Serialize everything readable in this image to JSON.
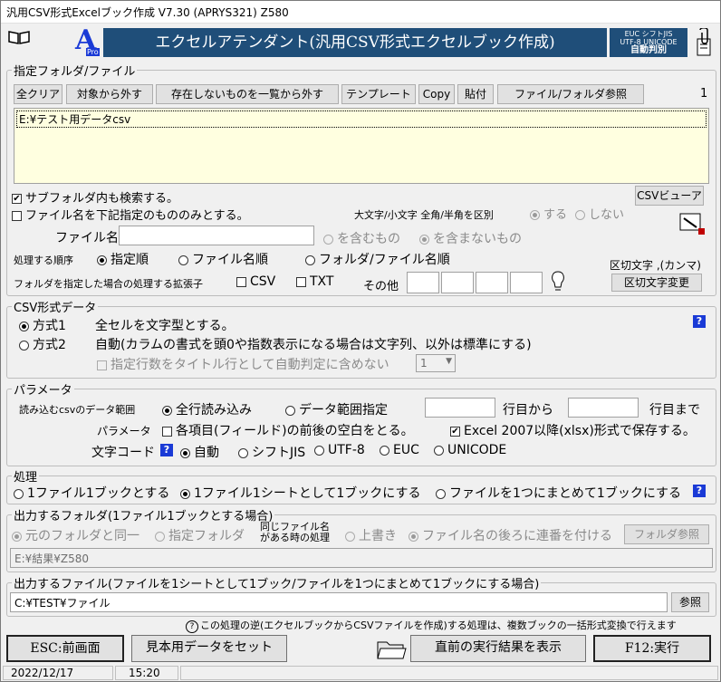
{
  "window": {
    "title": "汎用CSV形式Excelブック作成 V7.30 (APRYS321)  Z580"
  },
  "banner": {
    "title": "エクセルアテンダント(汎用CSV形式エクセルブック作成)"
  },
  "logo_right": {
    "line1": "EUC  シフトJIS",
    "line2": "UTF-8 UNICODE",
    "line3": "自動判別"
  },
  "logo_left": {
    "letter": "A",
    "sub": "Pro"
  },
  "files": {
    "legend": "指定フォルダ/ファイル",
    "toolbar": [
      "全クリア",
      "対象から外す",
      "存在しないものを一覧から外す",
      "テンプレート",
      "Copy",
      "貼付",
      "ファイル/フォルダ参照"
    ],
    "count": "1",
    "list": [
      "E:¥テスト用データcsv"
    ],
    "subfolder": "サブフォルダ内も検索する。",
    "only_named": "ファイル名を下記指定のもののみとする。",
    "csv_viewer": "CSVビューア",
    "case_label": "大文字/小文字 全角/半角を区別",
    "case_yes": "する",
    "case_no": "しない",
    "filename_label": "ファイル名に",
    "contains": "を含むもの",
    "not_contains": "を含まないもの",
    "order_label": "処理する順序",
    "order_opts": [
      "指定順",
      "ファイル名順",
      "フォルダ/ファイル名順"
    ],
    "delimiter_label": "区切文字 ,(カンマ)",
    "ext_label": "フォルダを指定した場合の処理する拡張子",
    "ext_csv": "CSV",
    "ext_txt": "TXT",
    "ext_other": "その他",
    "delimiter_button": "区切文字変更"
  },
  "csv_format": {
    "legend": "CSV形式データ",
    "method1": "方式1",
    "method1_desc": "全セルを文字型とする。",
    "method2": "方式2",
    "method2_desc": "自動(カラムの書式を頭0や指数表示になる場合は文字列、以外は標準にする)",
    "title_row": "指定行数をタイトル行として自動判定に含めない",
    "title_row_value": "1"
  },
  "params": {
    "legend": "パラメータ",
    "range_label": "読み込むcsvのデータ範囲",
    "all_rows": "全行読み込み",
    "range_specify": "データ範囲指定",
    "row_from": "行目から",
    "row_to": "行目まで",
    "param_label": "パラメータ",
    "trim": "各項目(フィールド)の前後の空白をとる。",
    "xlsx": "Excel 2007以降(xlsx)形式で保存する。",
    "encoding_label": "文字コード",
    "encodings": [
      "自動",
      "シフトJIS",
      "UTF-8",
      "EUC",
      "UNICODE"
    ]
  },
  "process": {
    "legend": "処理",
    "opts": [
      "1ファイル1ブックとする",
      "1ファイル1シートとして1ブックにする",
      "ファイルを1つにまとめて1ブックにする"
    ]
  },
  "out_folder": {
    "legend": "出力するフォルダ(1ファイル1ブックとする場合)",
    "same": "元のフォルダと同一",
    "specify": "指定フォルダ",
    "same_name_label1": "同じファイル名",
    "same_name_label2": "がある時の処理",
    "overwrite": "上書き",
    "serial": "ファイル名の後ろに連番を付ける",
    "browse": "フォルダ参照",
    "path": "E:¥結果¥Z580"
  },
  "out_file": {
    "legend": "出力するファイル(ファイルを1シートとして1ブック/ファイルを1つにまとめて1ブックにする場合)",
    "path": "C:¥TEST¥ファイル",
    "browse": "参照"
  },
  "hint": "この処理の逆(エクセルブックからCSVファイルを作成)する処理は、複数ブックの一括形式変換で行えます",
  "buttons": {
    "back": "ESC:前画面",
    "sample": "見本用データをセット",
    "last_result": "直前の実行結果を表示",
    "run": "F12:実行"
  },
  "statusbar": {
    "date": "2022/12/17",
    "time": "15:20"
  }
}
